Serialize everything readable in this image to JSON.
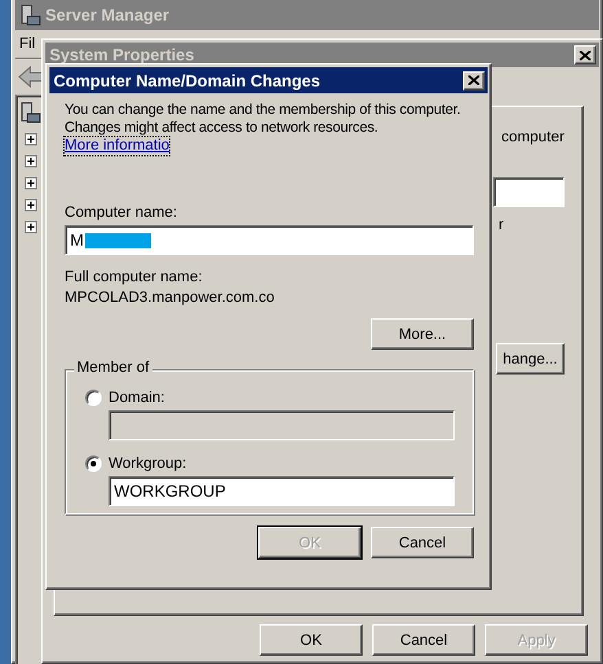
{
  "server_manager": {
    "title": "Server Manager",
    "menu": [
      "Fil"
    ],
    "tree_nodes": [
      {
        "expanded": false
      },
      {
        "expanded": false
      },
      {
        "expanded": false
      },
      {
        "expanded": false
      },
      {
        "expanded": false
      }
    ]
  },
  "system_properties": {
    "title": "System Properties",
    "behind": {
      "text_tail": "computer",
      "text_tail_2": "r",
      "change_button": "hange..."
    },
    "buttons": [
      {
        "label": "OK",
        "disabled": false
      },
      {
        "label": "Cancel",
        "disabled": false
      },
      {
        "label": "Apply",
        "disabled": true
      }
    ]
  },
  "dialog": {
    "title": "Computer Name/Domain Changes",
    "intro": "You can change the name and the membership of this computer. Changes might affect access to network resources.",
    "link": "More informatio",
    "computer_name_label": "Computer name:",
    "computer_name_value": "M",
    "full_name_label": "Full computer name:",
    "full_name_value": "MPCOLAD3.manpower.com.co",
    "more_button": "More...",
    "member_of": {
      "legend": "Member of",
      "options": [
        {
          "label": "Domain:",
          "selected": false,
          "field_disabled": true
        },
        {
          "label": "Workgroup:",
          "selected": true,
          "field_disabled": false,
          "value": "WORKGROUP"
        }
      ]
    },
    "buttons": [
      {
        "label": "OK",
        "disabled": true,
        "default": true
      },
      {
        "label": "Cancel",
        "disabled": false,
        "default": false
      }
    ]
  }
}
